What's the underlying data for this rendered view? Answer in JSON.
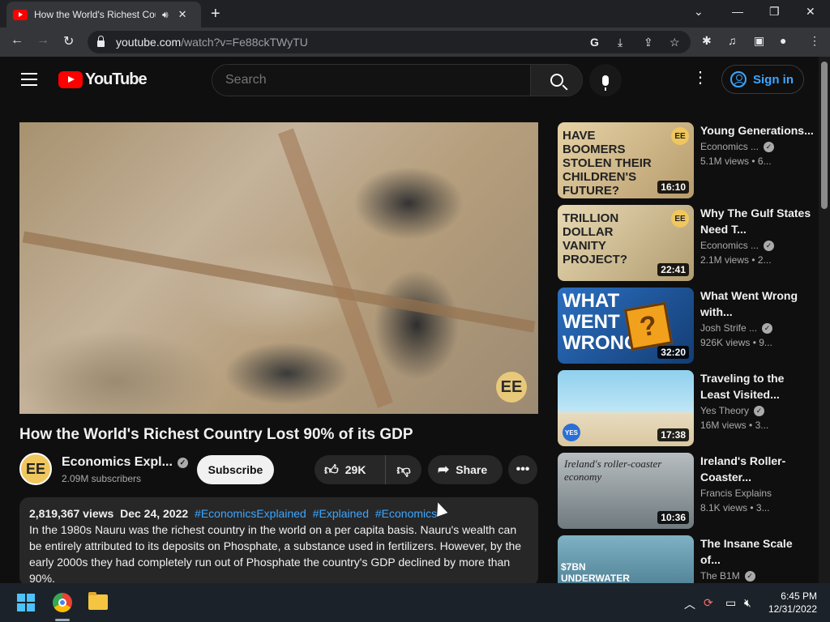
{
  "browser": {
    "tab_title": "How the World's Richest Cou",
    "url_host": "youtube.com",
    "url_path": "/watch?v=Fe88ckTWyTU"
  },
  "header": {
    "logo_text": "YouTube",
    "search_placeholder": "Search",
    "signin_label": "Sign in"
  },
  "video": {
    "title": "How the World's Richest Country Lost 90% of its GDP",
    "watermark": "EE",
    "channel_name": "Economics Expl...",
    "channel_avatar": "EE",
    "subscribers": "2.09M subscribers",
    "subscribe_label": "Subscribe",
    "likes": "29K",
    "share_label": "Share",
    "views": "2,819,367 views",
    "date": "Dec 24, 2022",
    "hashtags": [
      "#EconomicsExplained",
      "#Explained",
      "#Economics"
    ],
    "description": "In the 1980s Nauru was the richest country in the world on a per capita basis. Nauru's wealth can be entirely attributed to its deposits on Phosphate, a substance used in fertilizers. However, by the early 2000s they had completely run out of Phosphate the country's GDP declined by more than 90%."
  },
  "sidebar": [
    {
      "title": "Young Generations...",
      "channel": "Economics ...",
      "views": "5.1M views",
      "age": "6...",
      "duration": "16:10",
      "thumb_text": "HAVE BOOMERS STOLEN THEIR CHILDREN'S FUTURE?",
      "thumb_bg": "#d9c39a",
      "thumb_badge": "EE"
    },
    {
      "title": "Why The Gulf States Need T...",
      "channel": "Economics ...",
      "views": "2.1M views",
      "age": "2...",
      "duration": "22:41",
      "thumb_text": "TRILLION DOLLAR VANITY PROJECT?",
      "thumb_bg": "#c8b48a",
      "thumb_badge": "EE"
    },
    {
      "title": "What Went Wrong with...",
      "channel": "Josh Strife ...",
      "views": "926K views",
      "age": "9...",
      "duration": "32:20",
      "thumb_text": "WHAT WENT WRONG",
      "thumb_bg": "#1f5ea8",
      "thumb_badge": ""
    },
    {
      "title": "Traveling to the Least Visited...",
      "channel": "Yes Theory",
      "views": "16M views",
      "age": "3...",
      "duration": "17:38",
      "thumb_text": "",
      "thumb_bg": "#7fc7e8",
      "thumb_badge": "YES"
    },
    {
      "title": "Ireland's Roller-Coaster...",
      "channel": "Francis Explains",
      "views": "8.1K views",
      "age": "3...",
      "duration": "10:36",
      "thumb_text": "Ireland's roller-coaster economy",
      "thumb_bg": "#9aa3a8",
      "thumb_badge": ""
    },
    {
      "title": "The Insane Scale of...",
      "channel": "The B1M",
      "views": "",
      "age": "",
      "duration": "",
      "thumb_text": "$7BN UNDERWATER",
      "thumb_bg": "#5a8a9c",
      "thumb_badge": ""
    }
  ],
  "taskbar": {
    "time": "6:45 PM",
    "date": "12/31/2022"
  }
}
